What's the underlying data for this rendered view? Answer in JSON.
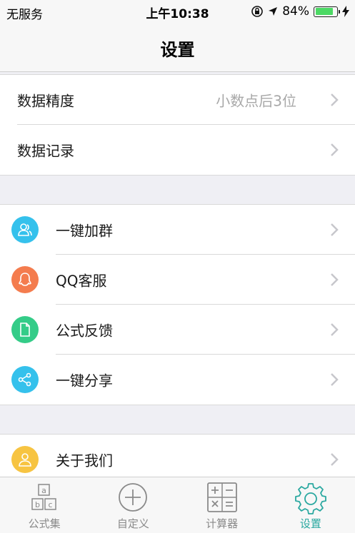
{
  "status_bar": {
    "carrier": "无服务",
    "time": "上午10:38",
    "battery": "84%",
    "battery_level": 0.84,
    "battery_color": "#4cd964"
  },
  "nav": {
    "title": "设置"
  },
  "settings_group1": [
    {
      "label": "数据精度",
      "value": "小数点后3位"
    },
    {
      "label": "数据记录"
    }
  ],
  "settings_group2": [
    {
      "label": "一键加群",
      "icon": "user-group-icon",
      "color": "#35c1ec"
    },
    {
      "label": "QQ客服",
      "icon": "qq-penguin-icon",
      "color": "#f47c4e"
    },
    {
      "label": "公式反馈",
      "icon": "document-icon",
      "color": "#34cc88"
    },
    {
      "label": "一键分享",
      "icon": "share-icon",
      "color": "#35c1ec"
    }
  ],
  "settings_group3": [
    {
      "label": "关于我们",
      "icon": "person-icon",
      "color": "#f7c442"
    }
  ],
  "tab_bar": {
    "active_color": "#2aa8a0",
    "tabs": [
      {
        "label": "公式集",
        "icon": "formula-blocks-icon"
      },
      {
        "label": "自定义",
        "icon": "plus-circle-icon"
      },
      {
        "label": "计算器",
        "icon": "calculator-icon"
      },
      {
        "label": "设置",
        "icon": "gear-icon",
        "active": true
      }
    ]
  }
}
